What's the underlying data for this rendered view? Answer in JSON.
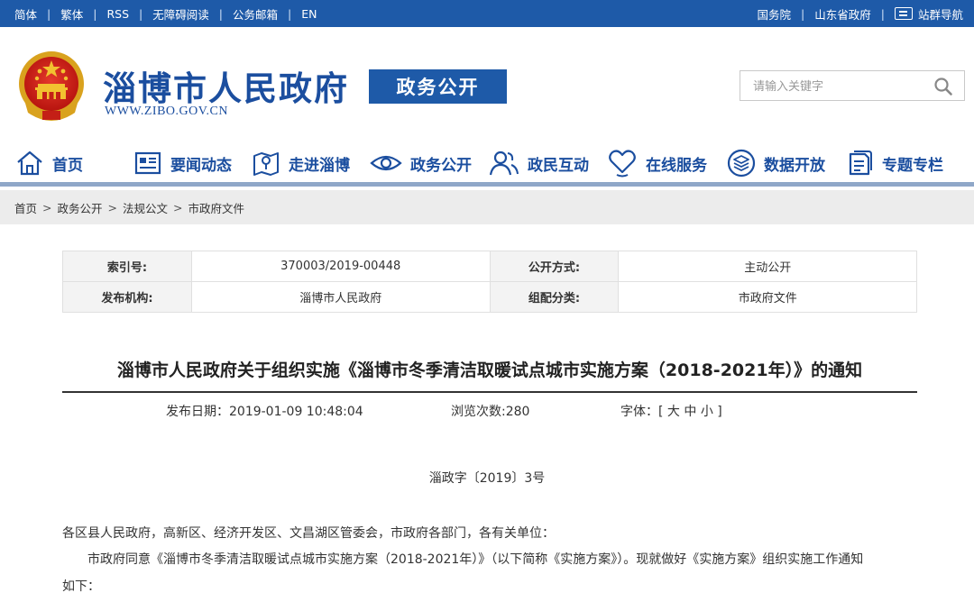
{
  "topbar": {
    "left_links": [
      "简体",
      "繁体",
      "RSS",
      "无障碍阅读",
      "公务邮箱",
      "EN"
    ],
    "right_links": [
      "国务院",
      "山东省政府"
    ],
    "site_nav_label": "站群导航"
  },
  "header": {
    "site_title": "淄博市人民政府",
    "site_url": "WWW.ZIBO.GOV.CN",
    "section_badge": "政务公开",
    "search_placeholder": "请输入关键字"
  },
  "nav": {
    "items": [
      {
        "label": "首页",
        "icon": "home-icon"
      },
      {
        "label": "要闻动态",
        "icon": "news-icon"
      },
      {
        "label": "走进淄博",
        "icon": "map-icon"
      },
      {
        "label": "政务公开",
        "icon": "eye-icon"
      },
      {
        "label": "政民互动",
        "icon": "people-icon"
      },
      {
        "label": "在线服务",
        "icon": "heart-hand-icon"
      },
      {
        "label": "数据开放",
        "icon": "layers-icon"
      },
      {
        "label": "专题专栏",
        "icon": "document-icon"
      }
    ]
  },
  "breadcrumb": [
    "首页",
    "政务公开",
    "法规公文",
    "市政府文件"
  ],
  "meta": {
    "index_label": "索引号:",
    "index_value": "370003/2019-00448",
    "publish_mode_label": "公开方式:",
    "publish_mode_value": "主动公开",
    "issuer_label": "发布机构:",
    "issuer_value": "淄博市人民政府",
    "category_label": "组配分类:",
    "category_value": "市政府文件"
  },
  "article": {
    "title": "淄博市人民政府关于组织实施《淄博市冬季清洁取暖试点城市实施方案（2018-2021年）》的通知",
    "date_label": "发布日期：",
    "date_value": "2019-01-09 10:48:04",
    "views_label": "浏览次数:",
    "views_value": "280",
    "font_label": "字体：[",
    "font_large": "大",
    "font_medium": "中",
    "font_small": "小",
    "font_close": "]",
    "doc_number": "淄政字〔2019〕3号",
    "recipients": "各区县人民政府，高新区、经济开发区、文昌湖区管委会，市政府各部门，各有关单位：",
    "body_line1": "市政府同意《淄博市冬季清洁取暖试点城市实施方案（2018-2021年）》（以下简称《实施方案》）。现就做好《实施方案》组织实施工作通知",
    "body_line2": "如下："
  },
  "colors": {
    "brand_blue": "#1e5aa8",
    "title_blue": "#1b4e9f",
    "breadcrumb_bg": "#ececec"
  }
}
